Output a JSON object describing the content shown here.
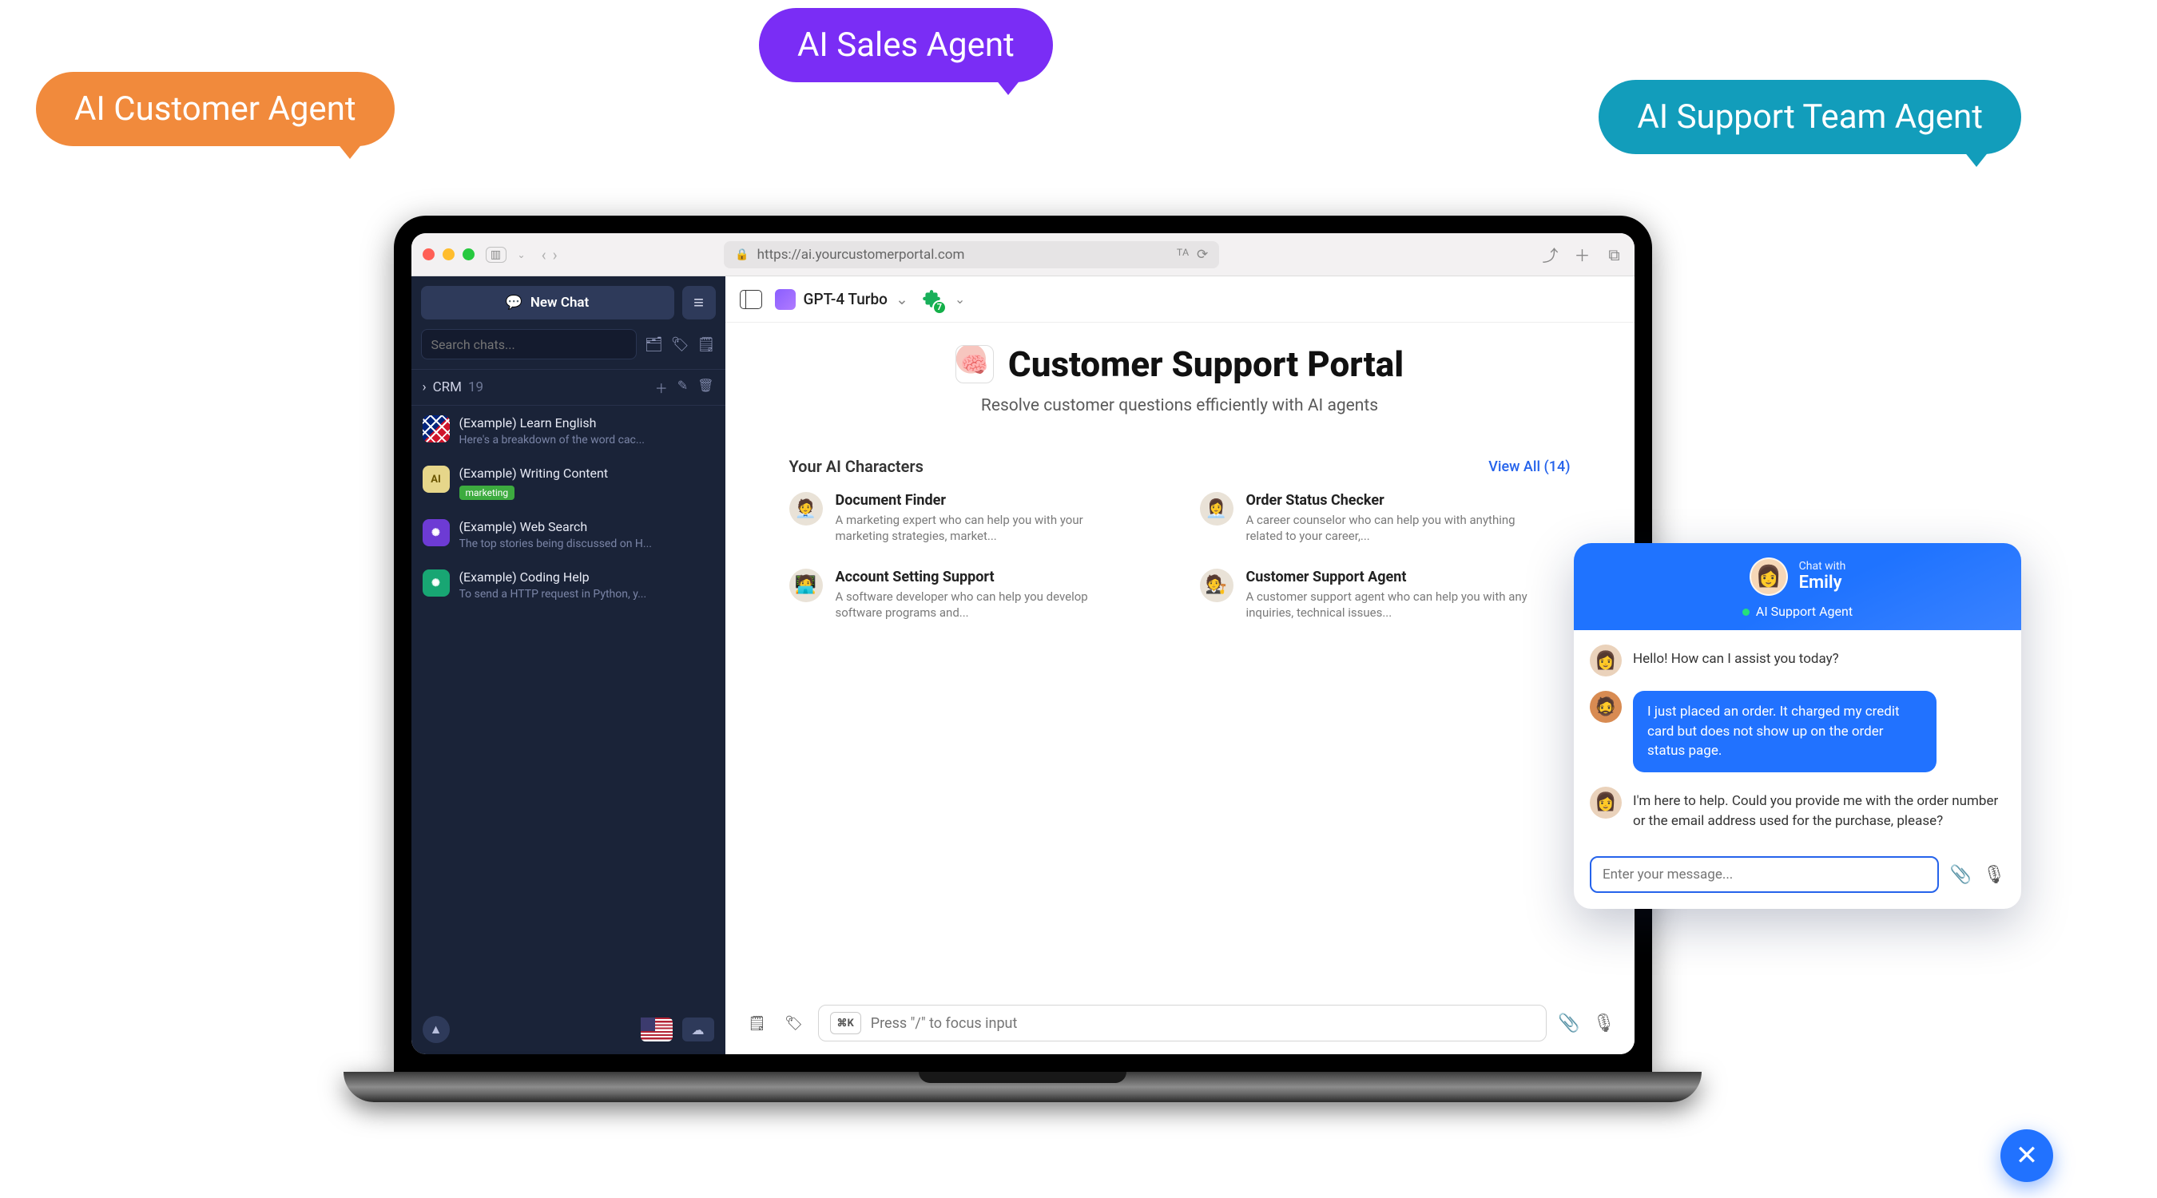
{
  "bubbles": {
    "customer": "AI Customer Agent",
    "sales": "AI Sales Agent",
    "support_team": "AI Support Team Agent"
  },
  "browser": {
    "url": "https://ai.yourcustomerportal.com"
  },
  "sidebar": {
    "new_chat": "New Chat",
    "search_placeholder": "Search chats...",
    "folder": {
      "name": "CRM",
      "count": "19"
    },
    "items": [
      {
        "title": "(Example) Learn English",
        "sub": "Here's a breakdown of the word cac..."
      },
      {
        "title": "(Example) Writing Content",
        "tag": "marketing"
      },
      {
        "title": "(Example) Web Search",
        "sub": "The top stories being discussed on H..."
      },
      {
        "title": "(Example) Coding Help",
        "sub": "To send a HTTP request in Python, y..."
      }
    ]
  },
  "topbar": {
    "model": "GPT-4 Turbo",
    "plugin_badge": "7"
  },
  "hero": {
    "title": "Customer Support Portal",
    "sub": "Resolve customer questions efficiently with AI agents"
  },
  "characters": {
    "heading": "Your AI Characters",
    "view_all": "View All (14)",
    "list": [
      {
        "title": "Document Finder",
        "desc": "A marketing expert who can help you with your marketing strategies, market..."
      },
      {
        "title": "Order Status Checker",
        "desc": "A career counselor who can help you with anything related to your career,..."
      },
      {
        "title": "Account Setting Support",
        "desc": "A software developer who can help you develop software programs and..."
      },
      {
        "title": "Customer Support Agent",
        "desc": "A customer support agent who can help you with any inquiries, technical issues..."
      }
    ]
  },
  "composer": {
    "shortcut": "⌘K",
    "placeholder": "Press \"/\" to focus input"
  },
  "chat_widget": {
    "header_small": "Chat with",
    "name": "Emily",
    "status": "AI Support Agent",
    "messages": {
      "m1": "Hello! How can I assist you today?",
      "m2": "I just placed an order. It charged my credit card but does not show up on the order status page.",
      "m3": "I'm here to help. Could you provide me with the order number or the email address used for the purchase, please?"
    },
    "input_placeholder": "Enter your message..."
  }
}
